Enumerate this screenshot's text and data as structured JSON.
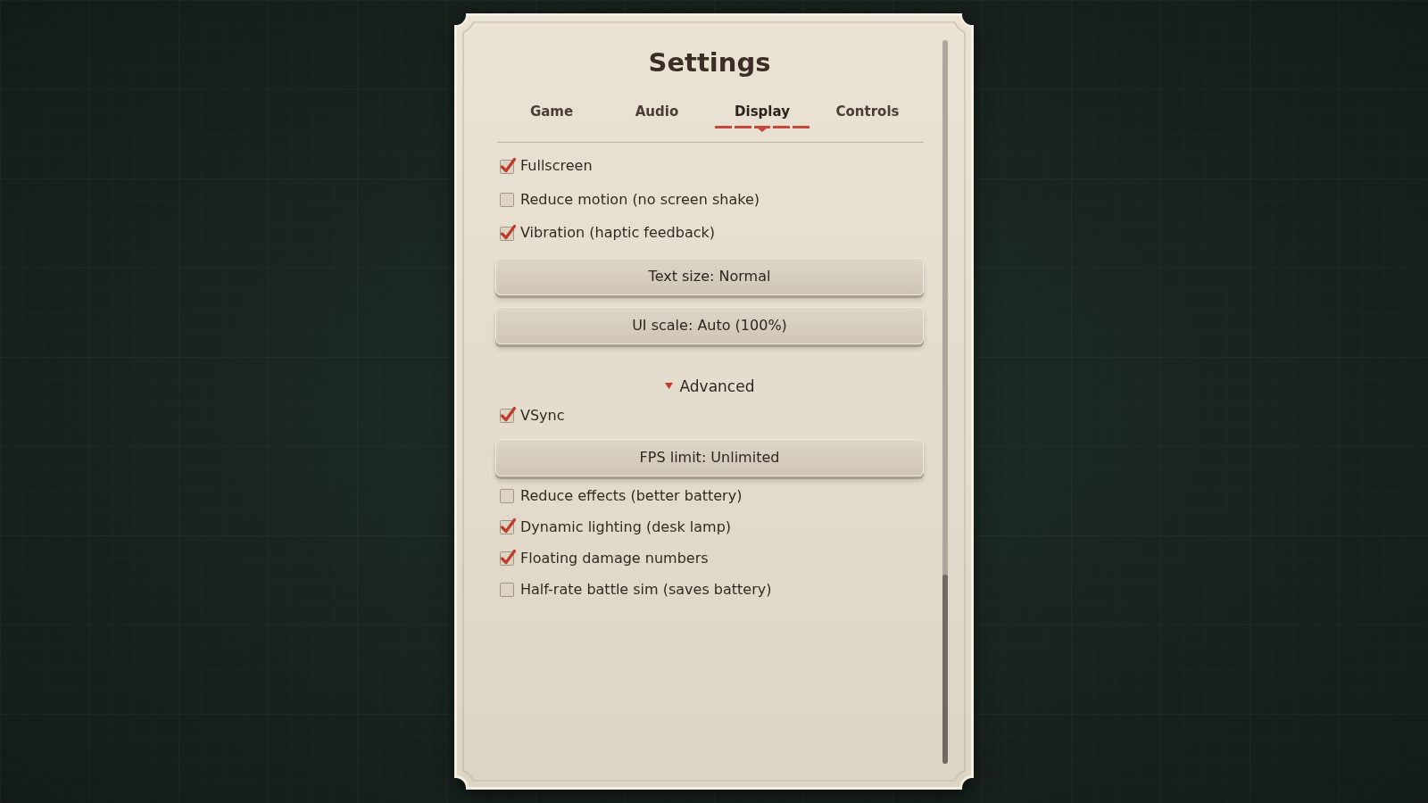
{
  "title": "Settings",
  "tabs": [
    {
      "label": "Game",
      "selected": false
    },
    {
      "label": "Audio",
      "selected": false
    },
    {
      "label": "Display",
      "selected": true
    },
    {
      "label": "Controls",
      "selected": false
    }
  ],
  "sections": [
    {
      "items": [
        {
          "kind": "checkbox",
          "label": "Fullscreen",
          "checked": true
        },
        {
          "kind": "checkbox",
          "label": "Reduce motion (no screen shake)",
          "checked": false
        },
        {
          "kind": "checkbox",
          "label": "Vibration (haptic feedback)",
          "checked": true
        },
        {
          "kind": "button",
          "label": "Text size: Normal"
        },
        {
          "kind": "button",
          "label": "UI scale: Auto (100%)"
        }
      ]
    },
    {
      "title": "Advanced",
      "expanded": true,
      "items": [
        {
          "kind": "checkbox",
          "label": "VSync",
          "checked": true
        },
        {
          "kind": "button",
          "label": "FPS limit: Unlimited"
        },
        {
          "kind": "checkbox",
          "label": "Reduce effects (better battery)",
          "checked": false
        },
        {
          "kind": "checkbox",
          "label": "Dynamic lighting (desk lamp)",
          "checked": true
        },
        {
          "kind": "checkbox",
          "label": "Floating damage numbers",
          "checked": true
        },
        {
          "kind": "checkbox",
          "label": "Half-rate battle sim (saves battery)",
          "checked": false
        }
      ]
    }
  ]
}
